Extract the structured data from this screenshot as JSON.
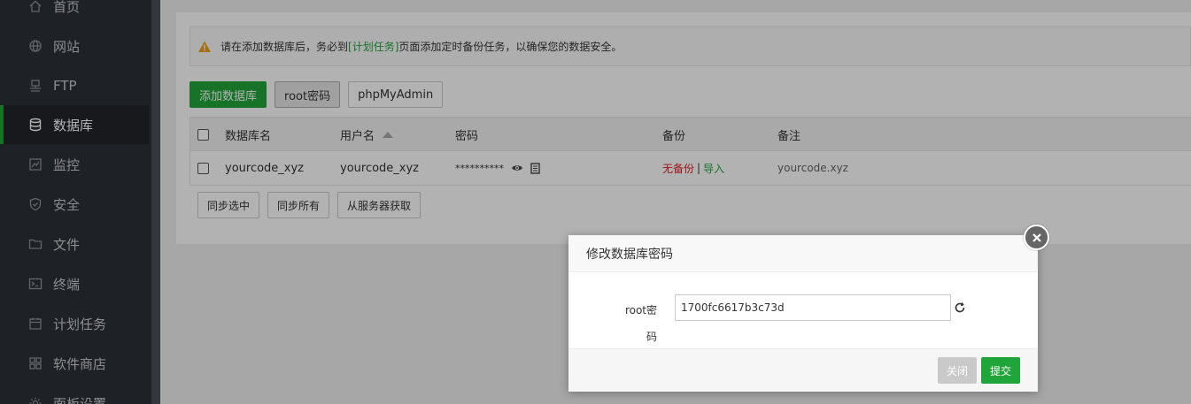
{
  "sidebar": {
    "items": [
      {
        "label": "首页",
        "icon": "home-icon"
      },
      {
        "label": "网站",
        "icon": "globe-icon"
      },
      {
        "label": "FTP",
        "icon": "ftp-icon"
      },
      {
        "label": "数据库",
        "icon": "database-icon",
        "active": true
      },
      {
        "label": "监控",
        "icon": "monitor-icon"
      },
      {
        "label": "安全",
        "icon": "shield-icon"
      },
      {
        "label": "文件",
        "icon": "folder-icon"
      },
      {
        "label": "终端",
        "icon": "terminal-icon"
      },
      {
        "label": "计划任务",
        "icon": "calendar-icon"
      },
      {
        "label": "软件商店",
        "icon": "apps-icon"
      },
      {
        "label": "面板设置",
        "icon": "gear-icon"
      }
    ]
  },
  "alert": {
    "before": "请在添加数据库后，务必到",
    "link": "[计划任务]",
    "after": "页面添加定时备份任务，以确保您的数据安全。"
  },
  "toolbar": {
    "add_db": "添加数据库",
    "root_pwd": "root密码",
    "phpmyadmin": "phpMyAdmin"
  },
  "table": {
    "headers": {
      "name": "数据库名",
      "user": "用户名",
      "password": "密码",
      "backup": "备份",
      "note": "备注"
    },
    "rows": [
      {
        "name": "yourcode_xyz",
        "user": "yourcode_xyz",
        "password": "**********",
        "backup_status": "无备份",
        "backup_sep": "|",
        "import": "导入",
        "note": "yourcode.xyz"
      }
    ]
  },
  "sync": {
    "selected": "同步选中",
    "all": "同步所有",
    "from_server": "从服务器获取"
  },
  "dialog": {
    "title": "修改数据库密码",
    "field_label": "root密码",
    "field_value": "1700fc6617b3c73d",
    "close_btn": "关闭",
    "submit_btn": "提交"
  },
  "colors": {
    "accent": "#20a53a",
    "danger": "#e02020",
    "sidebar_bg": "#2c3138"
  }
}
